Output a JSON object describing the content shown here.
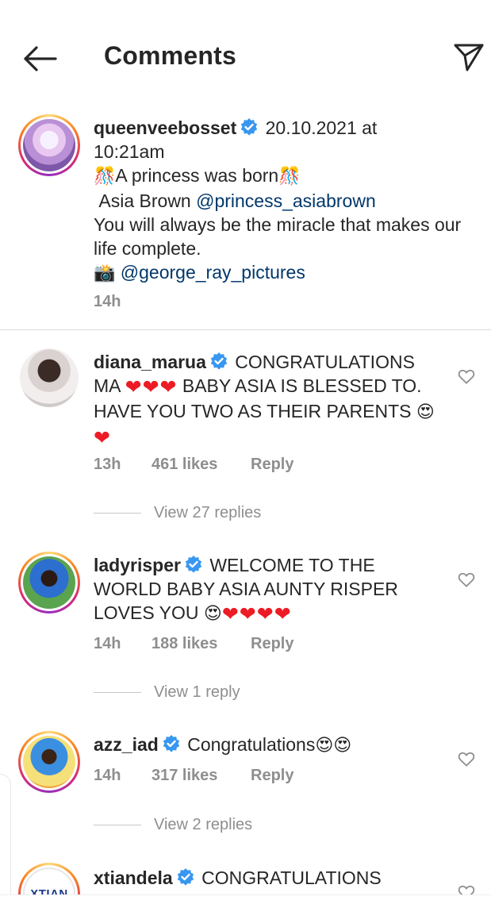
{
  "header": {
    "title": "Comments",
    "back_icon": "arrow-left-icon",
    "send_icon": "paper-plane-icon"
  },
  "post": {
    "username": "queenveebosset",
    "date": "20.10.2021 at",
    "time": "10:21am",
    "line1_emoji": "🎊",
    "line1_text": "A princess was born",
    "line2_prefix": "Asia Brown ",
    "line2_mention": "@princess_asiabrown",
    "line3": "You will always be the miracle that makes our life complete.",
    "line4_emoji": "📸",
    "line4_mention": "@george_ray_pictures",
    "age": "14h"
  },
  "comments": [
    {
      "username": "diana_marua",
      "text_a": "CONGRATULATIONS MA ",
      "hearts_a": "❤❤❤",
      "text_b": " BABY ASIA IS BLESSED TO. HAVE YOU TWO AS THEIR PARENTS ",
      "emoji_end": "😍",
      "hearts_end": "❤",
      "age": "13h",
      "likes": "461 likes",
      "reply": "Reply",
      "view_replies": "View 27 replies"
    },
    {
      "username": "ladyrisper",
      "text_a": "WELCOME TO THE WORLD BABY ASIA AUNTY RISPER LOVES YOU ",
      "emoji_end": "😍",
      "hearts_end": "❤❤❤❤",
      "age": "14h",
      "likes": "188 likes",
      "reply": "Reply",
      "view_replies": "View 1 reply"
    },
    {
      "username": "azz_iad",
      "text_a": "Congratulations",
      "emoji_end": "😍😍",
      "age": "14h",
      "likes": "317 likes",
      "reply": "Reply",
      "view_replies": "View 2 replies"
    },
    {
      "username": "xtiandela",
      "text_a": "CONGRATULATIONS",
      "logo_text_a": "XTIAN",
      "logo_text_b": ""
    }
  ],
  "colors": {
    "text": "#262626",
    "secondary": "#8e8e8e",
    "mention": "#00376b",
    "verified": "#3897f0",
    "heart": "#ed1c24"
  }
}
